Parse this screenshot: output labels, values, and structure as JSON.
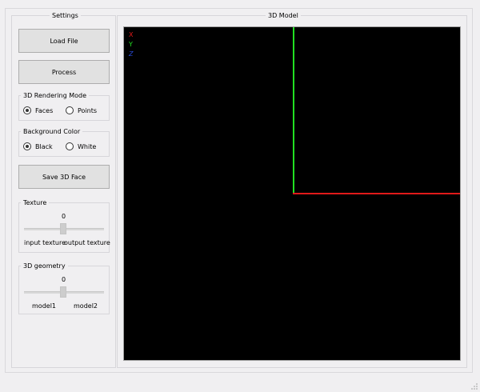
{
  "settings": {
    "title": "Settings",
    "load_file": "Load File",
    "process": "Process",
    "rendering_mode": {
      "title": "3D Rendering Mode",
      "options": [
        "Faces",
        "Points"
      ],
      "selected": "Faces"
    },
    "background_color": {
      "title": "Background Color",
      "options": [
        "Black",
        "White"
      ],
      "selected": "Black"
    },
    "save_face": "Save 3D Face",
    "texture": {
      "title": "Texture",
      "value": "0",
      "left_label": "input texture",
      "right_label": "output texture"
    },
    "geometry": {
      "title": "3D geometry",
      "value": "0",
      "left_label": "model1",
      "right_label": "model2"
    }
  },
  "model": {
    "title": "3D Model",
    "axis_labels": [
      "X",
      "Y",
      "Z"
    ],
    "axis_colors": [
      "#e01a1a",
      "#22e022",
      "#2a4bd8"
    ]
  }
}
